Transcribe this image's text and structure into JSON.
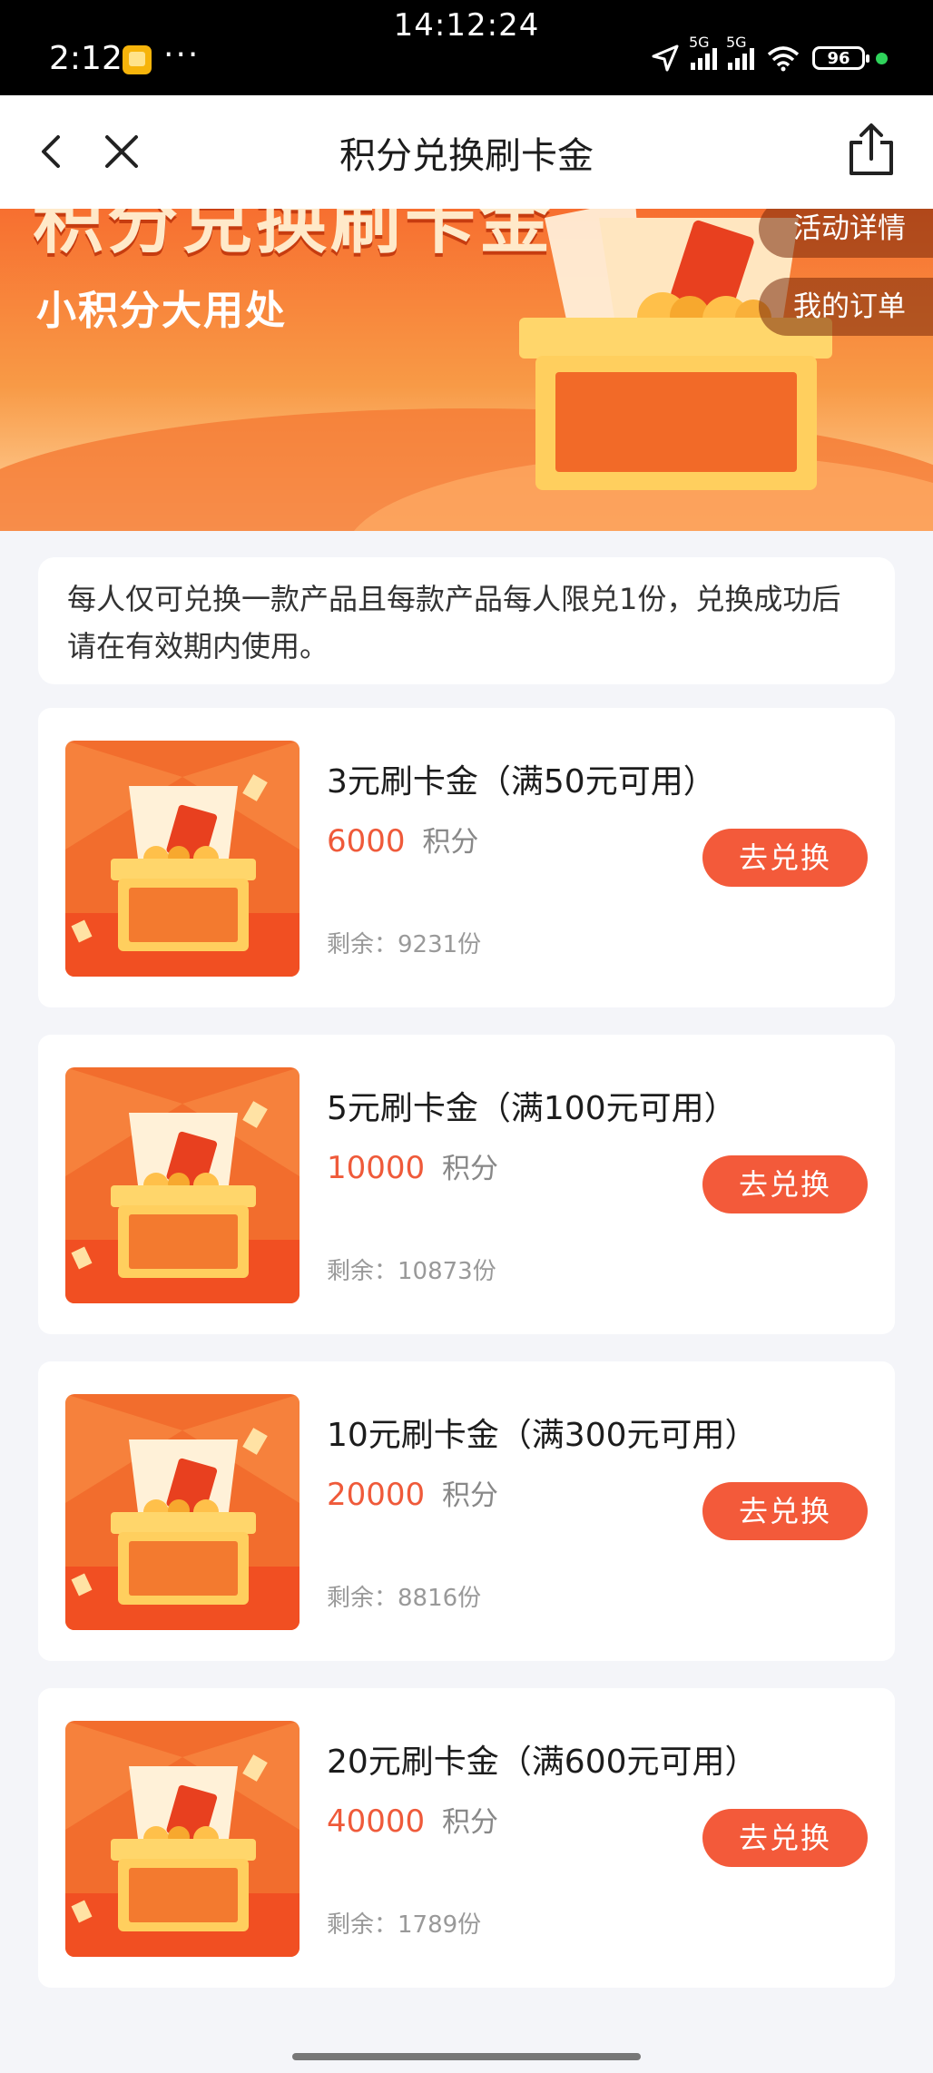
{
  "status_bar": {
    "clock_top": "14:12:24",
    "time": "2:12",
    "more": "···",
    "signal_1_label": "5G",
    "signal_2_label": "5G",
    "battery": "96"
  },
  "header": {
    "title": "积分兑换刷卡金"
  },
  "banner": {
    "title": "积分兑换刷卡金",
    "subtitle": "小积分大用处",
    "details_label": "活动详情",
    "orders_label": "我的订单"
  },
  "notice": {
    "text": "每人仅可兑换一款产品且每款产品每人限兑1份，兑换成功后请在有效期内使用。"
  },
  "products": [
    {
      "title": "3元刷卡金（满50元可用）",
      "points": "6000",
      "points_unit": "积分",
      "remaining": "剩余：9231份",
      "button": "去兑换"
    },
    {
      "title": "5元刷卡金（满100元可用）",
      "points": "10000",
      "points_unit": "积分",
      "remaining": "剩余：10873份",
      "button": "去兑换"
    },
    {
      "title": "10元刷卡金（满300元可用）",
      "points": "20000",
      "points_unit": "积分",
      "remaining": "剩余：8816份",
      "button": "去兑换"
    },
    {
      "title": "20元刷卡金（满600元可用）",
      "points": "40000",
      "points_unit": "积分",
      "remaining": "剩余：1789份",
      "button": "去兑换"
    }
  ],
  "colors": {
    "accent": "#f35a3a",
    "points": "#ef5a3a",
    "banner_orange": "#f76f30"
  }
}
